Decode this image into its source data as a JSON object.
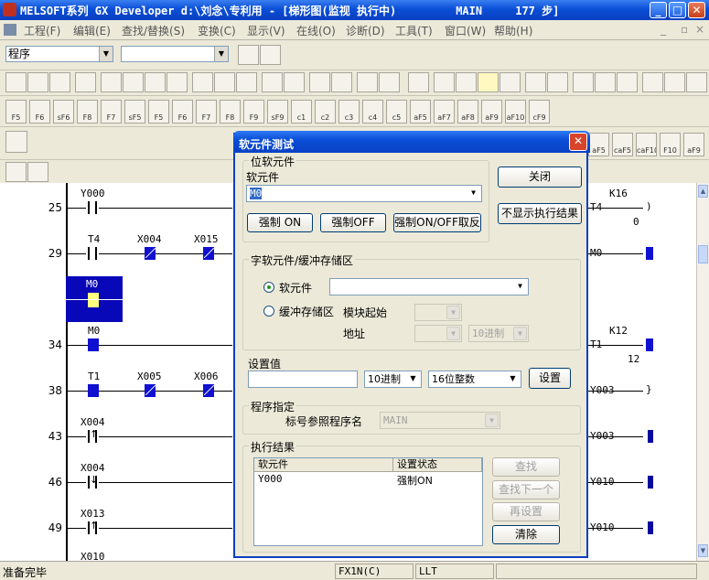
{
  "window": {
    "title": "MELSOFT系列 GX Developer d:\\刘念\\专利用 - [梯形图(监视 执行中)         MAIN     177 步]",
    "min": "_",
    "max": "□",
    "close": "✕"
  },
  "menu": [
    "工程(F)",
    "编辑(E)",
    "查找/替换(S)",
    "变换(C)",
    "显示(V)",
    "在线(O)",
    "诊断(D)",
    "工具(T)",
    "窗口(W)",
    "帮助(H)"
  ],
  "toolbar": {
    "program_combo": "程序",
    "second_combo": ""
  },
  "fkeys": [
    "F5",
    "F6",
    "sF6",
    "F8",
    "F7",
    "sF5",
    "F5",
    "F6",
    "F7",
    "F8",
    "F9",
    "sF9",
    "c1",
    "c2",
    "c3",
    "c4",
    "c5",
    "aF5",
    "aF7",
    "aF8",
    "aF9",
    "aF10",
    "cF9"
  ],
  "fkeys_right": [
    "aF5",
    "caF5",
    "caF10",
    "F10",
    "aF9"
  ],
  "ladder": {
    "steps": [
      {
        "num": "25"
      },
      {
        "num": "29"
      },
      {
        "num": "34"
      },
      {
        "num": "38"
      },
      {
        "num": "43"
      },
      {
        "num": "46"
      },
      {
        "num": "49"
      }
    ],
    "labels": {
      "y000": "Y000",
      "t4": "T4",
      "x004a": "X004",
      "x015": "X015",
      "m0a": "M0",
      "m0b": "M0",
      "t1": "T1",
      "x005": "X005",
      "x006": "X006",
      "x004b": "X004",
      "x004c": "X004",
      "x013": "X013",
      "x010": "X010"
    },
    "right": {
      "k16": "K16",
      "t4": "T4",
      "zero": "0",
      "m0": "M0",
      "k12": "K12",
      "t1": "T1",
      "twelve": "12",
      "y003a": "Y003",
      "y003b": "Y003",
      "y010a": "Y010",
      "y010b": "Y010"
    }
  },
  "status": {
    "ready": "准备完毕",
    "plc": "FX1N(C)",
    "mode": "LLT"
  },
  "dialog": {
    "title": "软元件测试",
    "bit_group": "位软元件",
    "device_label": "软元件",
    "device_value": "M0",
    "force_on": "强制 ON",
    "force_off": "强制OFF",
    "force_toggle": "强制ON/OFF取反",
    "close": "关闭",
    "hide_results": "不显示执行结果",
    "word_group": "字软元件/缓冲存储区",
    "radio_device": "软元件",
    "radio_buffer": "缓冲存储区",
    "module_start": "模块起始",
    "address": "地址",
    "addr_format": "10进制",
    "set_value": "设置值",
    "set_format": "10进制",
    "set_type": "16位整数",
    "set_button": "设置",
    "program_group": "程序指定",
    "label_ref": "标号参照程序名",
    "program_name": "MAIN",
    "results_group": "执行结果",
    "col_device": "软元件",
    "col_state": "设置状态",
    "results": [
      {
        "device": "Y000",
        "state": "强制ON"
      }
    ],
    "find": "查找",
    "find_next": "查找下一个",
    "reset": "再设置",
    "clear": "清除"
  }
}
